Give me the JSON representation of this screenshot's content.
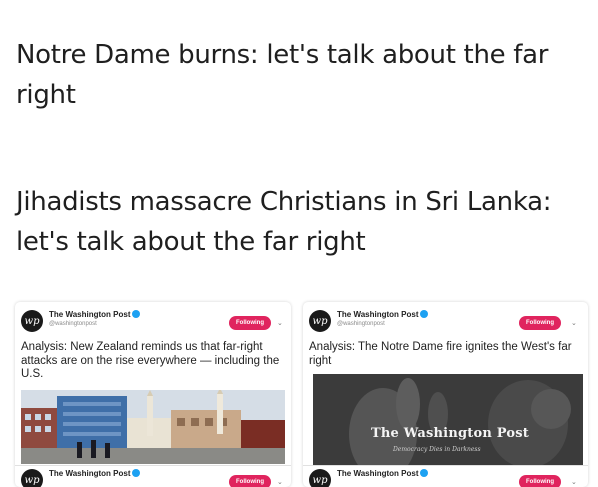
{
  "headlines": [
    "Notre Dame burns: let's talk about the far right",
    "Jihadists massacre Christians in Sri Lanka: let's talk about the far right"
  ],
  "tweets": [
    {
      "account": "The Washington Post",
      "handle": "@washingtonpost",
      "follow_label": "Following",
      "text": "Analysis: New Zealand reminds us that far-right attacks are on the rise everywhere — including the U.S."
    },
    {
      "account": "The Washington Post",
      "handle": "@washingtonpost",
      "follow_label": "Following",
      "text": "Analysis: The Notre Dame fire ignites the West's far right",
      "image_brand": "The Washington Post",
      "image_tagline": "Democracy Dies in Darkness"
    },
    {
      "account": "The Washington Post",
      "follow_label": "Following"
    },
    {
      "account": "The Washington Post",
      "follow_label": "Following"
    }
  ],
  "logo_text": "wp",
  "icons": {
    "verified": "verified-badge-icon",
    "chevron": "chevron-down-icon",
    "logo": "washington-post-logo-icon"
  },
  "colors": {
    "follow_button": "#e0245e",
    "verified": "#1da1f2"
  }
}
